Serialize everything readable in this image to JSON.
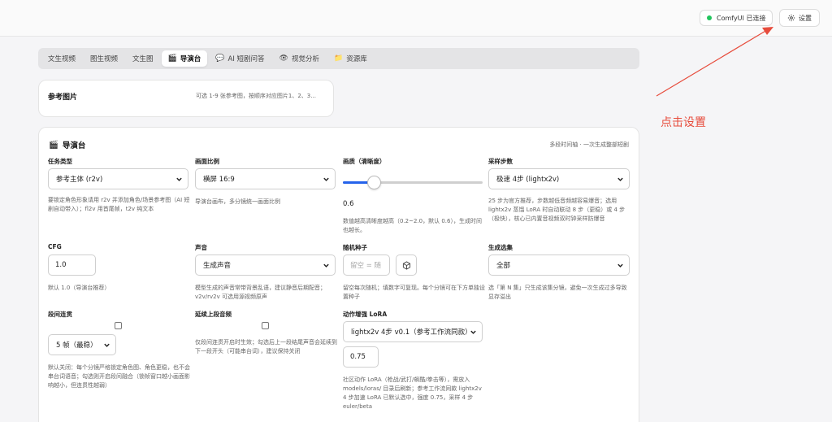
{
  "header": {
    "status_label": "ComfyUI 已连接",
    "status_color": "#22c55e",
    "settings_label": "设置"
  },
  "tabs": [
    {
      "label": "文生视频",
      "icon": ""
    },
    {
      "label": "图生视频",
      "icon": ""
    },
    {
      "label": "文生图",
      "icon": ""
    },
    {
      "label": "导演台",
      "icon": "clapperboard-icon",
      "active": true
    },
    {
      "label": "AI 短剧问答",
      "icon": "chat-bubble-icon"
    },
    {
      "label": "视觉分析",
      "icon": "eye-icon"
    },
    {
      "label": "资源库",
      "icon": "folder-icon"
    }
  ],
  "reference": {
    "title": "参考图片",
    "hint": "可选 1-9 张参考图，按顺序对应图片1、2、3..."
  },
  "director": {
    "title": "导演台",
    "hint": "多段时间轴 · 一次生成整部短剧",
    "task_type": {
      "label": "任务类型",
      "value": "参考主体 (r2v)",
      "desc": "要锁定角色形象请用 r2v 并添加角色/场景参考图（AI 短剧自动带入）；fl2v 用首尾帧，t2v 纯文本"
    },
    "aspect": {
      "label": "画面比例",
      "value": "横屏 16:9",
      "desc": "导演台画布，多分镜统一画面比例"
    },
    "quality": {
      "label": "画质（清晰度）",
      "value": "0.6",
      "level": 0.6,
      "min": 0.2,
      "max": 2.0,
      "desc": "数值越高清晰度越高（0.2~2.0，默认 0.6），生成时间也越长。"
    },
    "steps": {
      "label": "采样步数",
      "value": "极速 4步 (lightx2v)",
      "desc": "25 步为官方推荐，步数越低音频越容易爆音；选用 lightx2v 蒸馏 LoRA 时自动联动 8 步（更稳）或 4 步（极快），核心已内置音视频双时钟采样防爆音"
    },
    "cfg": {
      "label": "CFG",
      "value": "1.0",
      "desc": "默认 1.0（导演台推荐）"
    },
    "audio": {
      "label": "声音",
      "value": "生成声音",
      "desc": "模型生成的声音常带背景乱语，建议静音后期配音；v2v/rv2v 可选用源视频原声"
    },
    "seed": {
      "label": "随机种子",
      "placeholder": "留空 = 随",
      "desc": "留空每次随机；填数字可复现。每个分镜可在下方单独设置种子"
    },
    "gen_set": {
      "label": "生成选集",
      "value": "全部",
      "desc": "选「第 N 集」只生成该集分镜，避免一次生成过多导致显存溢出"
    },
    "continuity": {
      "label": "段间连贯",
      "value": "5 帧（最稳）",
      "desc": "默认关闭：每个分镜严格锁定角色图、角色更稳，也不会串台词语音；勾选则开启段间融合（锁帧窗口越小画面影响越小，但连贯性越弱）"
    },
    "extend_audio": {
      "label": "延续上段音频",
      "desc": "仅段间连贯开启时生效；勾选后上一段结尾声音会延续到下一段开头（可能串台词），建议保持关闭"
    },
    "motion_lora": {
      "label": "动作增强 LoRA",
      "value": "lightx2v 4步 v0.1（参考工作流同款）",
      "strength": "0.75",
      "desc": "社区动作 LoRA（枪战/武打/飙酷/拳击等），需放入 models/loras/ 目录后刷新；参考工作流同款 lightx2v 4 步加速 LoRA 已默认选中，强度 0.75，采样 4 步 euler/beta"
    }
  },
  "annotation": {
    "text": "点击设置",
    "color": "#e74c3c"
  }
}
